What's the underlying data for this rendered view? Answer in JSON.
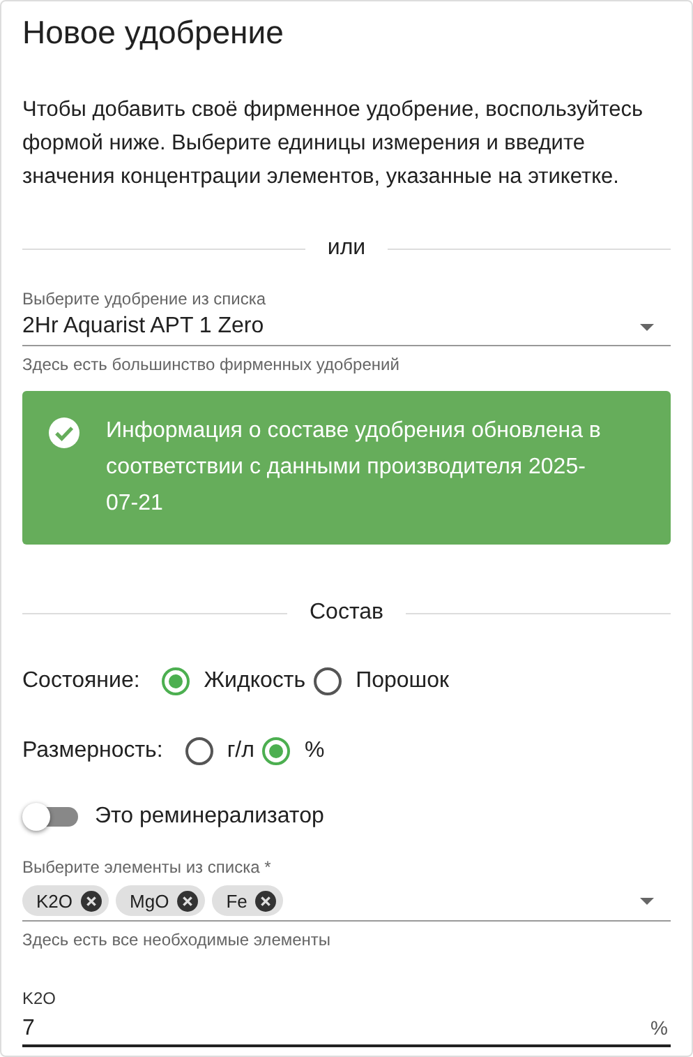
{
  "title": "Новое удобрение",
  "intro": "Чтобы добавить своё фирменное удобрение, воспользуйтесь формой ниже. Выберите единицы измерения и введите значения концентрации элементов, указанные на этикетке.",
  "divider_1": "или",
  "fertilizer_select": {
    "label": "Выберите удобрение из списка",
    "value": "2Hr Aquarist APT 1 Zero",
    "hint": "Здесь есть большинство фирменных удобрений"
  },
  "alert": {
    "text": "Информация о составе удобрения обновлена в соответствии с данными производителя 2025-07-21"
  },
  "divider_2": "Состав",
  "radio_groups": [
    {
      "label": "Состояние:",
      "options": [
        {
          "label": "Жидкость",
          "selected": true
        },
        {
          "label": "Порошок",
          "selected": false
        }
      ]
    },
    {
      "label": "Размерность:",
      "options": [
        {
          "label": "г/л",
          "selected": false
        },
        {
          "label": "%",
          "selected": true
        }
      ]
    }
  ],
  "remineralizer_switch": {
    "label": "Это реминерализатор",
    "on": false
  },
  "elements_select": {
    "label": "Выберите элементы из списка *",
    "chips": [
      "K2O",
      "MgO",
      "Fe"
    ],
    "hint": "Здесь есть все необходимые элементы"
  },
  "concentration_field": {
    "label": "K2O",
    "value": "7",
    "suffix": "%"
  }
}
